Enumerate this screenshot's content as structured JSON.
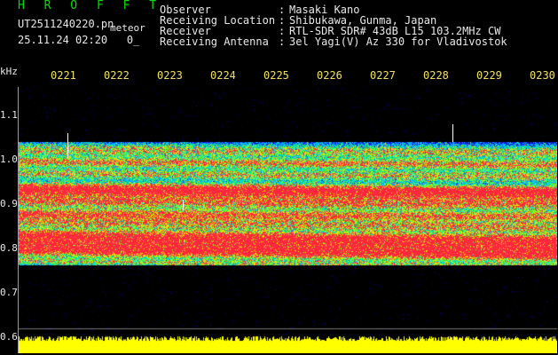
{
  "left_panel": {
    "title": "H R O F F T",
    "filename": "UT2511240220.pn",
    "meteor_label": "meteor",
    "datetime": "25.11.24 02:20",
    "counter": "0_"
  },
  "header": {
    "fields": [
      {
        "label": "Observer",
        "sep": ":",
        "value": "Masaki Kano"
      },
      {
        "label": "Receiving Location",
        "sep": ":",
        "value": "Shibukawa, Gunma, Japan"
      },
      {
        "label": "Receiver",
        "sep": ":",
        "value": "RTL-SDR SDR# 43dB L15 103.2MHz CW"
      },
      {
        "label": "Receiving Antenna",
        "sep": ":",
        "value": "3el Yagi(V) Az 330 for Vladivostok"
      }
    ]
  },
  "time_axis": {
    "ticks": [
      "0221",
      "0222",
      "0223",
      "0224",
      "0225",
      "0226",
      "0227",
      "0228",
      "0229",
      "0230"
    ]
  },
  "freq_axis": {
    "unit": "kHz",
    "labels": [
      "1.1",
      "1.0",
      "0.9",
      "0.8",
      "0.7",
      "0.6"
    ]
  },
  "colors": {
    "title": "#00e000",
    "tick": "#f0e060",
    "text": "#e8e8e8",
    "noise_bar": "#ffff00"
  }
}
